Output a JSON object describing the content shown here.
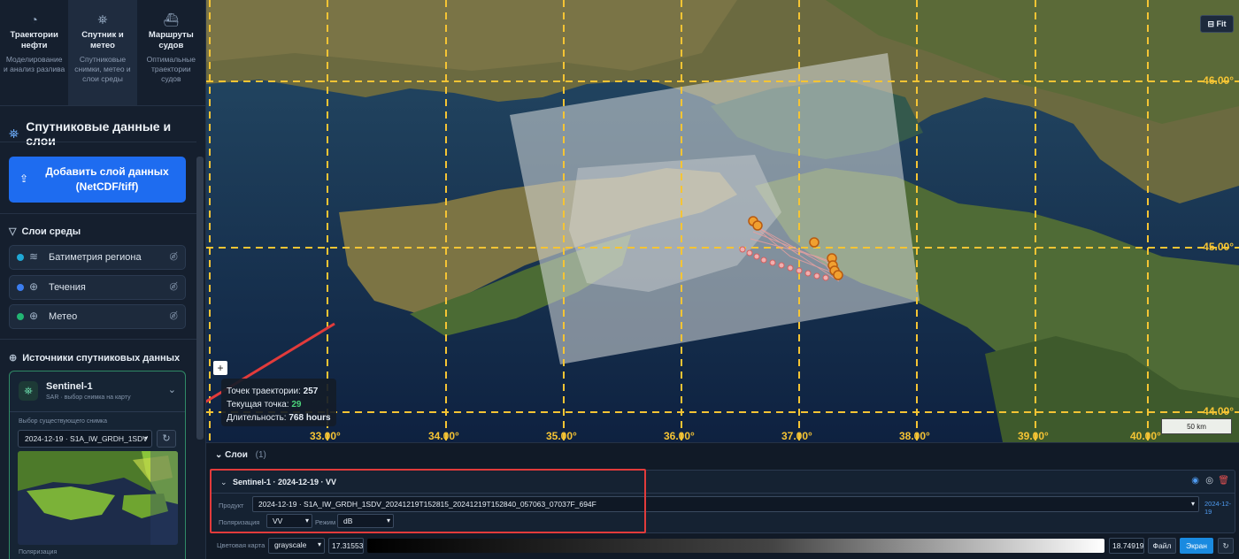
{
  "tabs": [
    {
      "title": "Траектории нефти",
      "desc": "Моделирование и анализ разлива",
      "icon": "droplet-icon"
    },
    {
      "title": "Спутник и метео",
      "desc": "Спутниковые снимки, метео и слои среды",
      "icon": "satellite-icon"
    },
    {
      "title": "Маршруты судов",
      "desc": "Оптимальные траектории судов",
      "icon": "ship-icon"
    }
  ],
  "sidebar": {
    "section_title": "Спутниковые данные и слои",
    "add_button": "Добавить слой данных (NetCDF/tiff)",
    "env_title": "Слои среды",
    "env_layers": [
      {
        "name": "Батиметрия региона",
        "color": "#1fa8d6",
        "icon": "waves-icon"
      },
      {
        "name": "Течения",
        "color": "#3b7df0",
        "icon": "globe-icon"
      },
      {
        "name": "Метео",
        "color": "#22b573",
        "icon": "globe-icon"
      }
    ],
    "sources_title": "Источники спутниковых данных",
    "source": {
      "name": "Sentinel-1",
      "desc": "SAR · выбор снимка на карту",
      "pick_label": "Выбор существующего снимка",
      "selected": "2024-12-19 · S1A_IW_GRDH_1SDV",
      "pol_label": "Поляризация"
    }
  },
  "map": {
    "fit_label": "Fit",
    "zoom_in": "+",
    "info": {
      "points_label": "Точек траектории:",
      "points": "257",
      "current_label": "Текущая точка:",
      "current": "29",
      "duration_label": "Длительность:",
      "duration": "768 hours"
    },
    "scale": "50 km",
    "lon_labels": [
      "33.00°",
      "34.00°",
      "35.00°",
      "36.00°",
      "37.00°",
      "38.00°",
      "39.00°",
      "40.00°"
    ],
    "lat_labels": [
      "46.00°",
      "45.00°",
      "44.00°"
    ]
  },
  "bottom": {
    "layers_title": "Слои",
    "layers_count": "(1)",
    "layer": {
      "title": "Sentinel-1 · 2024-12-19 · VV",
      "product_label": "Продукт",
      "product": "2024-12-19 · S1A_IW_GRDH_1SDV_20241219T152815_20241219T152840_057063_07037F_694F",
      "product_date": "2024-12-19",
      "pol_label": "Поляризация",
      "pol_value": "VV",
      "mode_label": "Режим",
      "mode_value": "dB"
    },
    "cmap_label": "Цветовая карта",
    "cmap_value": "grayscale",
    "min_value": "17.31553",
    "max_value": "18.74919",
    "file_btn": "Файл",
    "screen_btn": "Экран"
  }
}
